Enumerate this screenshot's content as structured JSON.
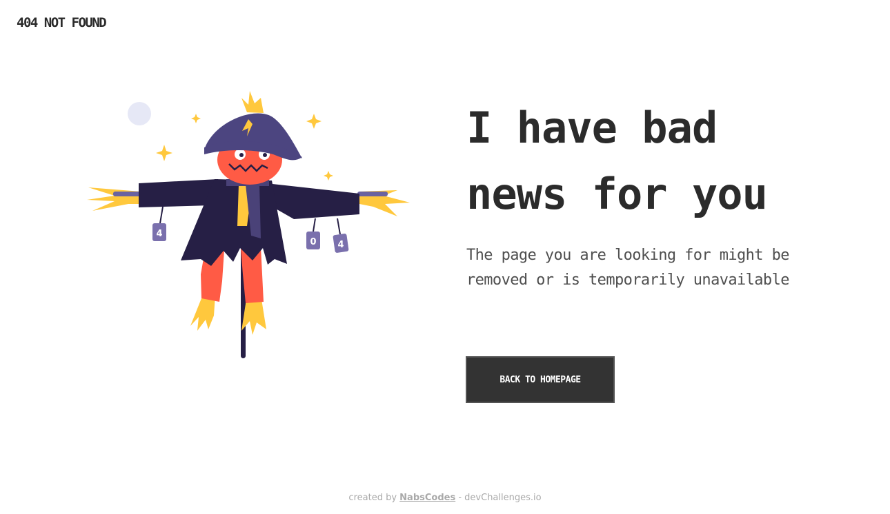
{
  "header": {
    "brand": "404 NOT FOUND"
  },
  "main": {
    "headline_line1": "I have bad",
    "headline_line2": "news for you",
    "description": "The page you are looking for might be removed or is temporarily unavailable",
    "back_button_label": "BACK TO HOMEPAGE"
  },
  "illustration": {
    "can_left": "4",
    "can_mid": "0",
    "can_right": "4",
    "colors": {
      "hat": "#4c4580",
      "coat": "#261f45",
      "pumpkin": "#ff5b45",
      "straw": "#ffc83d",
      "moon": "#e6e8f6",
      "scarf": "#4a4278"
    }
  },
  "footer": {
    "prefix": "created by",
    "author": "NabsCodes",
    "suffix": "- devChallenges.io"
  }
}
